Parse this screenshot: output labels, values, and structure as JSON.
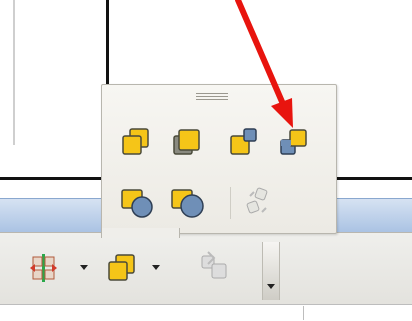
{
  "icons": {
    "bring_to_front": "bring-to-front-icon",
    "bring_forward": "bring-forward-icon",
    "send_backward": "send-backward-icon",
    "send_to_back": "send-to-back-icon",
    "in_front_of_object": "in-front-of-object-icon",
    "behind_object": "behind-object-icon",
    "reverse": "reverse-icon",
    "align": "align-icon",
    "arrange": "arrange-icon",
    "group": "group-icon"
  },
  "colors": {
    "shape_fill": "#f5c518",
    "shape_back_fill": "#6f8fb7",
    "arrow": "#e8140e"
  }
}
